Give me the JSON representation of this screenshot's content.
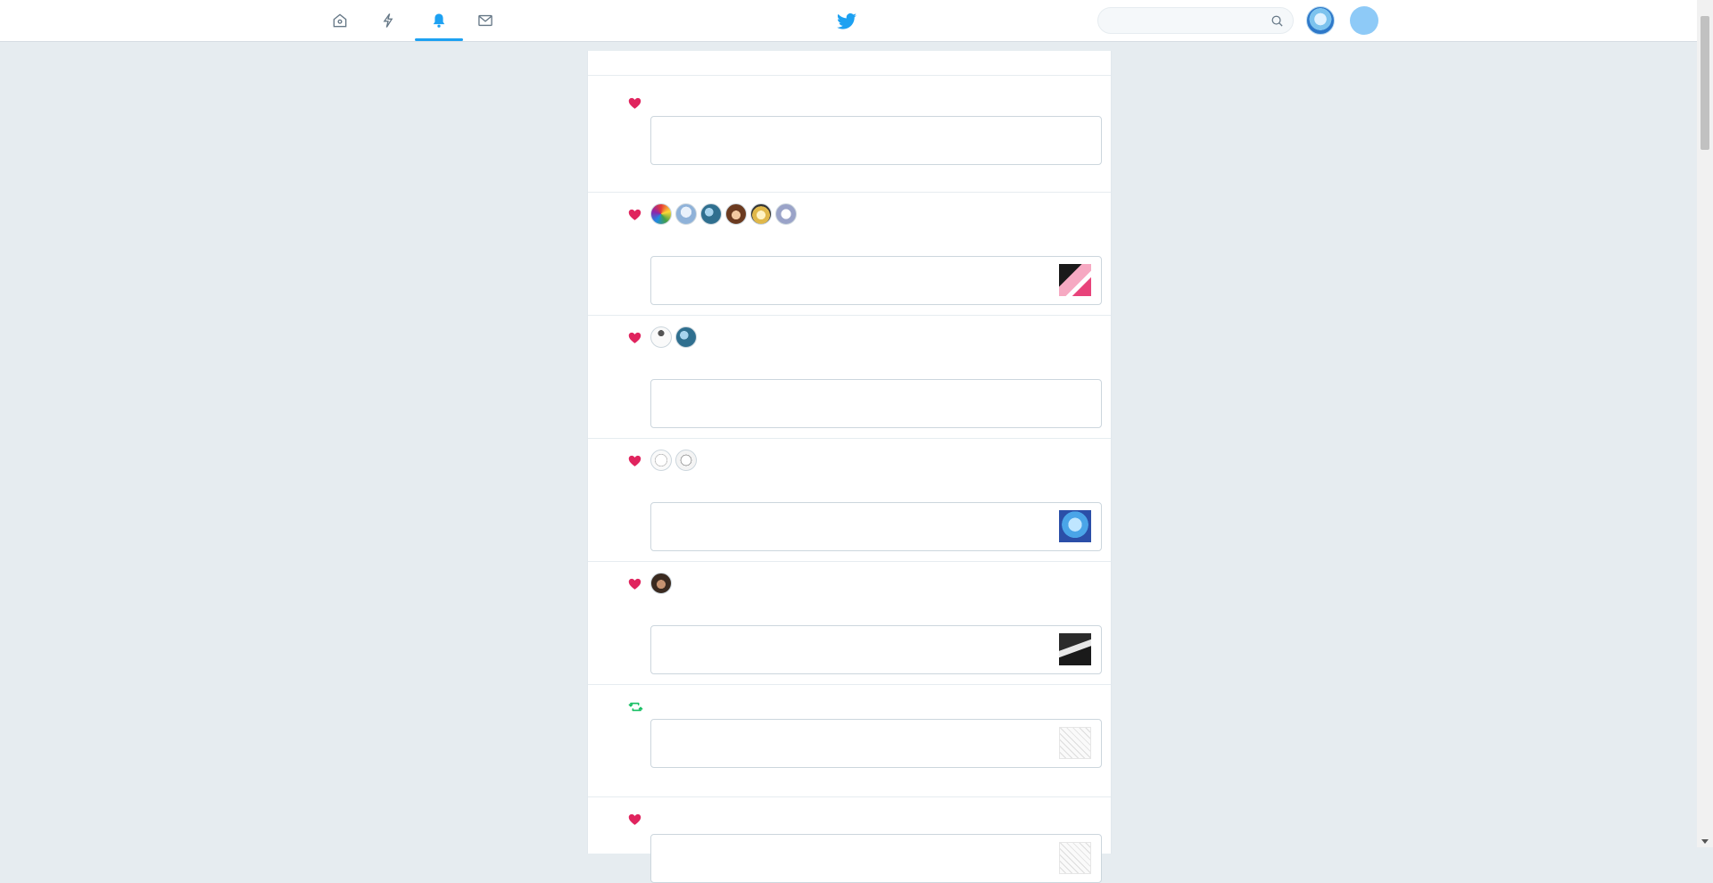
{
  "nav": {
    "items": [
      {
        "id": "home",
        "icon": "home-icon",
        "label": ""
      },
      {
        "id": "moments",
        "icon": "lightning-icon",
        "label": ""
      },
      {
        "id": "notifications",
        "icon": "bell-icon",
        "label": ""
      },
      {
        "id": "messages",
        "icon": "envelope-icon",
        "label": ""
      }
    ],
    "active": "notifications"
  },
  "logo": {
    "icon": "twitter-bird-icon"
  },
  "search": {
    "placeholder": "",
    "value": "",
    "icon": "search-icon"
  },
  "colors": {
    "accent": "#1da1f2",
    "like": "#e0245e",
    "retweet": "#17bf63",
    "background": "#e6ecf0"
  },
  "notifications": [
    {
      "type": "like",
      "icon": "heart-icon",
      "avatars": [],
      "quote_thumb": null
    },
    {
      "type": "like",
      "icon": "heart-icon",
      "avatars": [
        "avatar-1",
        "avatar-2",
        "avatar-3",
        "avatar-4",
        "avatar-5",
        "avatar-6"
      ],
      "quote_thumb": "thumb-pink"
    },
    {
      "type": "like",
      "icon": "heart-icon",
      "avatars": [
        "avatar-1",
        "avatar-2"
      ],
      "quote_thumb": null
    },
    {
      "type": "like",
      "icon": "heart-icon",
      "avatars": [
        "avatar-1",
        "avatar-2"
      ],
      "quote_thumb": "thumb-blue"
    },
    {
      "type": "like",
      "icon": "heart-icon",
      "avatars": [
        "avatar-1"
      ],
      "quote_thumb": "thumb-dark"
    },
    {
      "type": "retweet",
      "icon": "retweet-icon",
      "avatars": [],
      "quote_thumb": "thumb-sketch"
    },
    {
      "type": "like",
      "icon": "heart-icon",
      "avatars": [],
      "quote_thumb": "thumb-sketch"
    }
  ]
}
